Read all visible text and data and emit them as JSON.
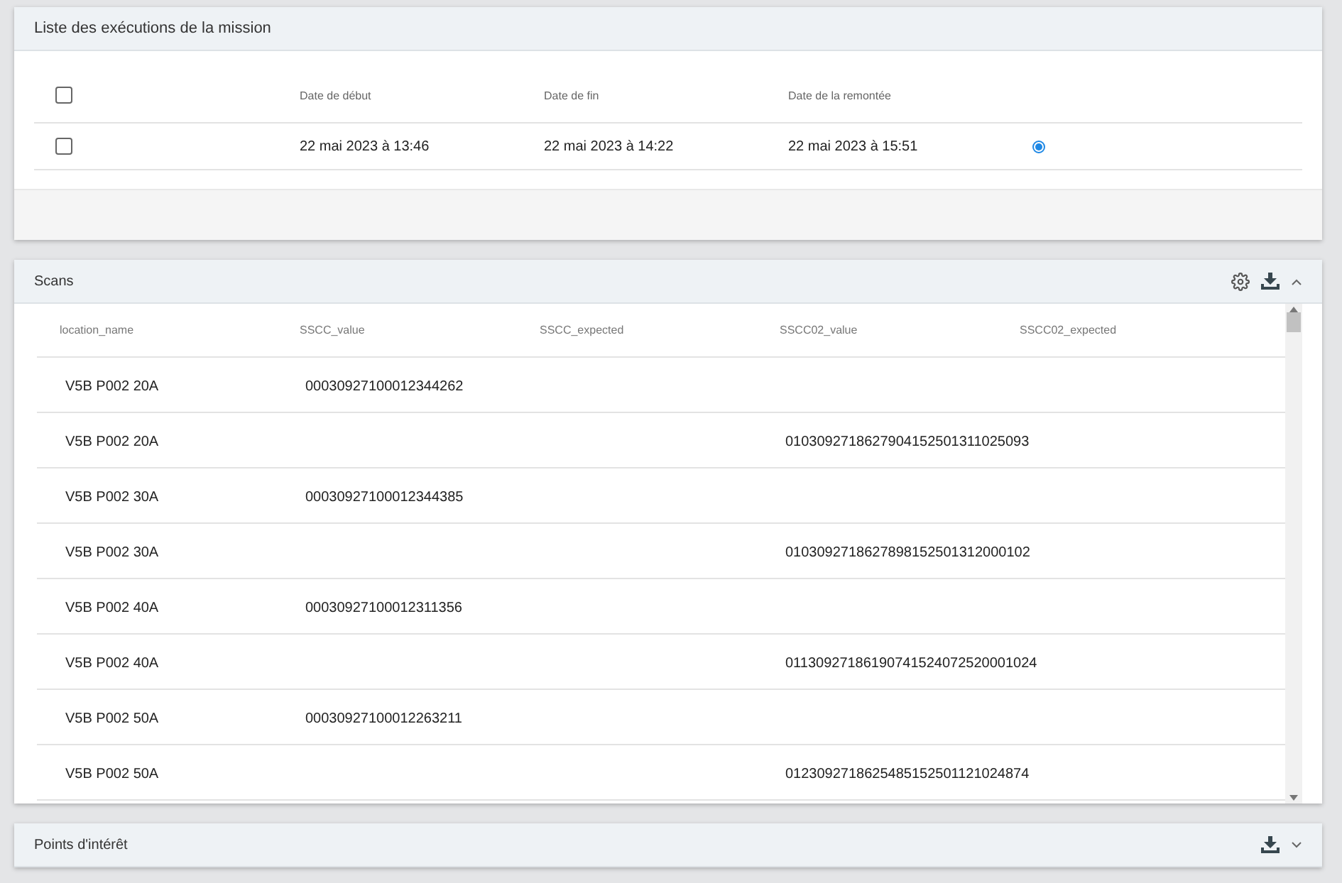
{
  "executions": {
    "title": "Liste des exécutions de la mission",
    "select_all": {
      "checked": false
    },
    "columns": [
      "Date de début",
      "Date de fin",
      "Date de la remontée"
    ],
    "rows": [
      {
        "checked": false,
        "start": "22 mai 2023 à 13:46",
        "end": "22 mai 2023 à 14:22",
        "upload": "22 mai 2023 à 15:51",
        "selected": true
      }
    ]
  },
  "scans": {
    "title": "Scans",
    "expanded": true,
    "columns": [
      "location_name",
      "SSCC_value",
      "SSCC_expected",
      "SSCC02_value",
      "SSCC02_expected"
    ],
    "rows": [
      [
        "V5B P002 20A",
        "00030927100012344262",
        "",
        "",
        ""
      ],
      [
        "V5B P002 20A",
        "",
        "",
        "0103092718627904152501311025093",
        ""
      ],
      [
        "V5B P002 30A",
        "00030927100012344385",
        "",
        "",
        ""
      ],
      [
        "V5B P002 30A",
        "",
        "",
        "0103092718627898152501312000102",
        ""
      ],
      [
        "V5B P002 40A",
        "00030927100012311356",
        "",
        "",
        ""
      ],
      [
        "V5B P002 40A",
        "",
        "",
        "01130927186190741524072520001024",
        ""
      ],
      [
        "V5B P002 50A",
        "00030927100012263211",
        "",
        "",
        ""
      ],
      [
        "V5B P002 50A",
        "",
        "",
        "0123092718625485152501121024874",
        ""
      ]
    ]
  },
  "points": {
    "title": "Points d'intérêt",
    "expanded": false
  }
}
